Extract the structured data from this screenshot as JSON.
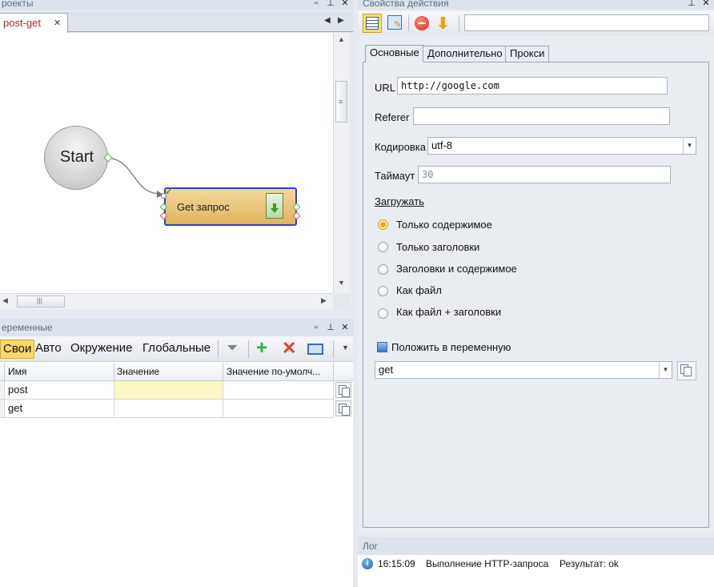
{
  "projects": {
    "title": "роекты",
    "tab": "post-get",
    "tab_close": "✕",
    "nodes": {
      "start": "Start",
      "get": "Get запрос"
    }
  },
  "variables": {
    "title": "еременные",
    "tabs": [
      "Свои",
      "Авто",
      "Окружение",
      "Глобальные"
    ],
    "columns": [
      "Имя",
      "Значение",
      "Значение по-умолч..."
    ],
    "rows": [
      {
        "name": "post",
        "value": "",
        "default": ""
      },
      {
        "name": "get",
        "value": "",
        "default": ""
      }
    ]
  },
  "props": {
    "title": "Свойства действия",
    "search_value": "",
    "tabs": [
      "Основные",
      "Дополнительно",
      "Прокси"
    ],
    "url_label": "URL",
    "url_value": "http://google.com",
    "referer_label": "Referer",
    "referer_value": "",
    "encoding_label": "Кодировка",
    "encoding_value": "utf-8",
    "timeout_label": "Таймаут",
    "timeout_value": "30",
    "load_label": "Загружать",
    "radios": [
      "Только содержимое",
      "Только заголовки",
      "Заголовки и содержимое",
      "Как файл",
      "Как файл + заголовки"
    ],
    "selected_radio": 0,
    "put_var_label": "Положить в переменную",
    "put_var_checked": false,
    "var_value": "get"
  },
  "log": {
    "title": "Лог",
    "time": "16:15:09",
    "message": "Выполнение HTTP-запроса",
    "result": "Результат: ok"
  },
  "colors": {
    "accent": "#f5d96b",
    "node": "#e8bf63",
    "node_border": "#3340c8",
    "panel_bg": "#e6e9ef"
  }
}
